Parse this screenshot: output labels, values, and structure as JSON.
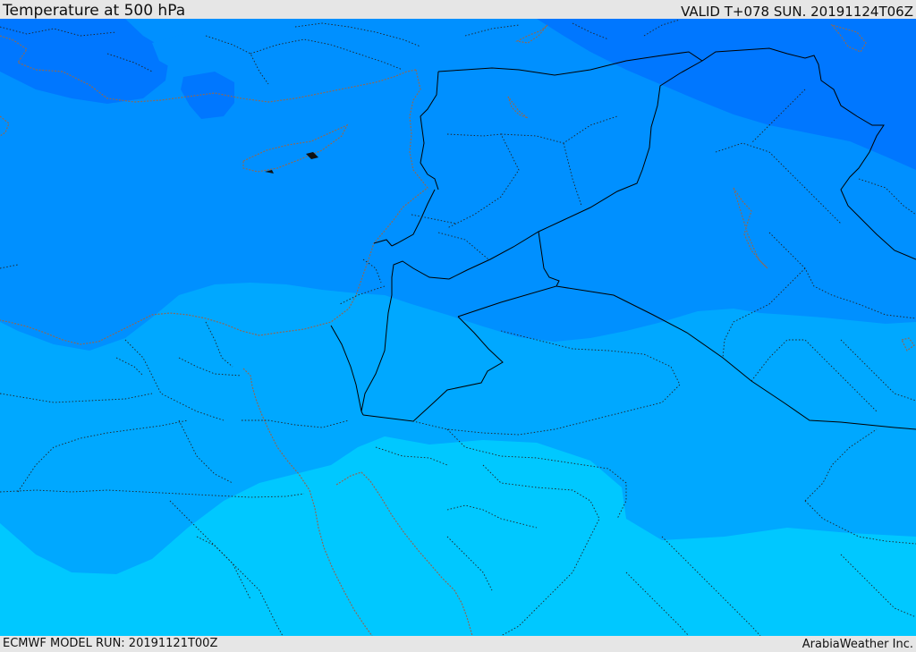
{
  "header": {
    "title": "Temperature at 500 hPa",
    "valid": "VALID T+078 SUN. 20191124T06Z"
  },
  "footer": {
    "model_run": "ECMWF MODEL RUN: 20191121T00Z",
    "credit": "ArabiaWeather Inc."
  },
  "colors": {
    "band_coldest": "#0077ff",
    "band_cold": "#0090ff",
    "band_mid": "#00a8ff",
    "band_warm": "#00c8ff",
    "country_border": "#000000",
    "admin_border": "#222222",
    "coastline": "#8a6a5a",
    "lake": "#8a6a5a"
  }
}
